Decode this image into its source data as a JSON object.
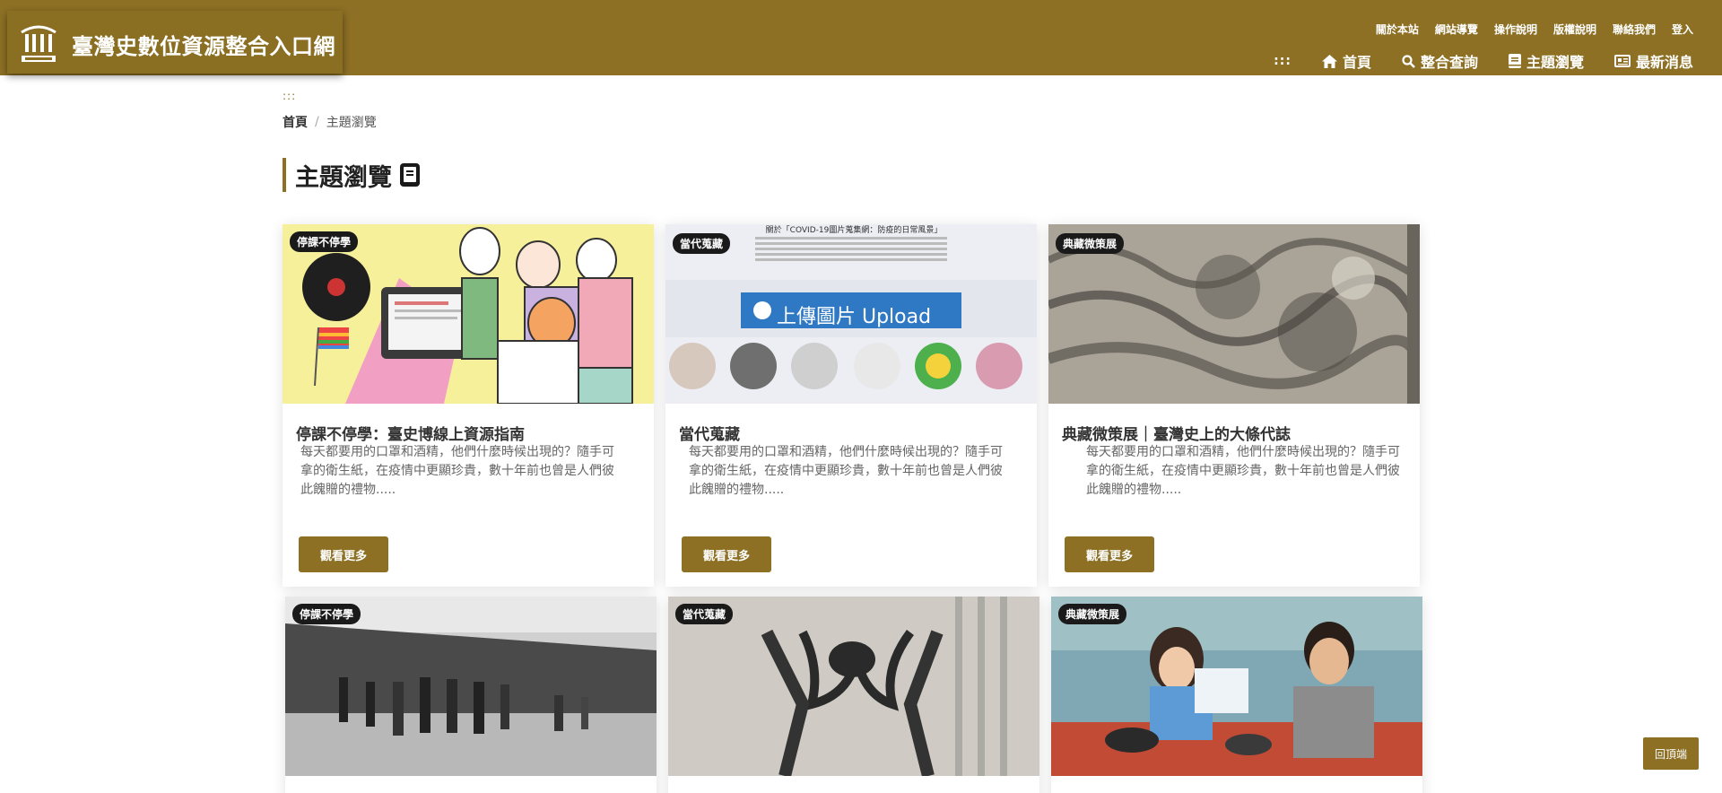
{
  "header": {
    "site_title": "臺灣史數位資源整合入口網",
    "top_links": [
      "關於本站",
      "網站導覽",
      "操作說明",
      "版權說明",
      "聯絡我們",
      "登入"
    ],
    "accent_color": "#8d7024",
    "nav_dots": ":::",
    "nav": [
      {
        "label": "首頁",
        "icon": "home-icon"
      },
      {
        "label": "整合查詢",
        "icon": "search-icon"
      },
      {
        "label": "主題瀏覽",
        "icon": "book-icon"
      },
      {
        "label": "最新消息",
        "icon": "newspaper-icon"
      }
    ]
  },
  "access_dots": ":::",
  "breadcrumb": {
    "home": "首頁",
    "separator": "/",
    "current": "主題瀏覽"
  },
  "page_title": "主題瀏覽",
  "cards": [
    {
      "badge": "停課不停學",
      "title": "停課不停學：臺史博線上資源指南",
      "desc": "每天都要用的口罩和酒精，他們什麼時候出現的？隨手可拿的衛生紙，在疫情中更顯珍貴，數十年前也曾是人們彼此餽贈的禮物.....",
      "button": "觀看更多"
    },
    {
      "badge": "當代蒐藏",
      "title": "當代蒐藏",
      "desc": "每天都要用的口罩和酒精，他們什麼時候出現的？隨手可拿的衛生紙，在疫情中更顯珍貴，數十年前也曾是人們彼此餽贈的禮物.....",
      "button": "觀看更多",
      "image_text": {
        "heading": "關於「COVID-19圖片蒐集網：防疫的日常風景」",
        "upload": "上傳圖片 Upload"
      }
    },
    {
      "badge": "典藏微策展",
      "title": "典藏微策展｜臺灣史上的大條代誌",
      "desc": "每天都要用的口罩和酒精，他們什麼時候出現的？隨手可拿的衛生紙，在疫情中更顯珍貴，數十年前也曾是人們彼此餽贈的禮物.....",
      "button": "觀看更多"
    },
    {
      "badge": "停課不停學"
    },
    {
      "badge": "當代蒐藏"
    },
    {
      "badge": "典藏微策展"
    }
  ],
  "back_to_top": "回頂端"
}
